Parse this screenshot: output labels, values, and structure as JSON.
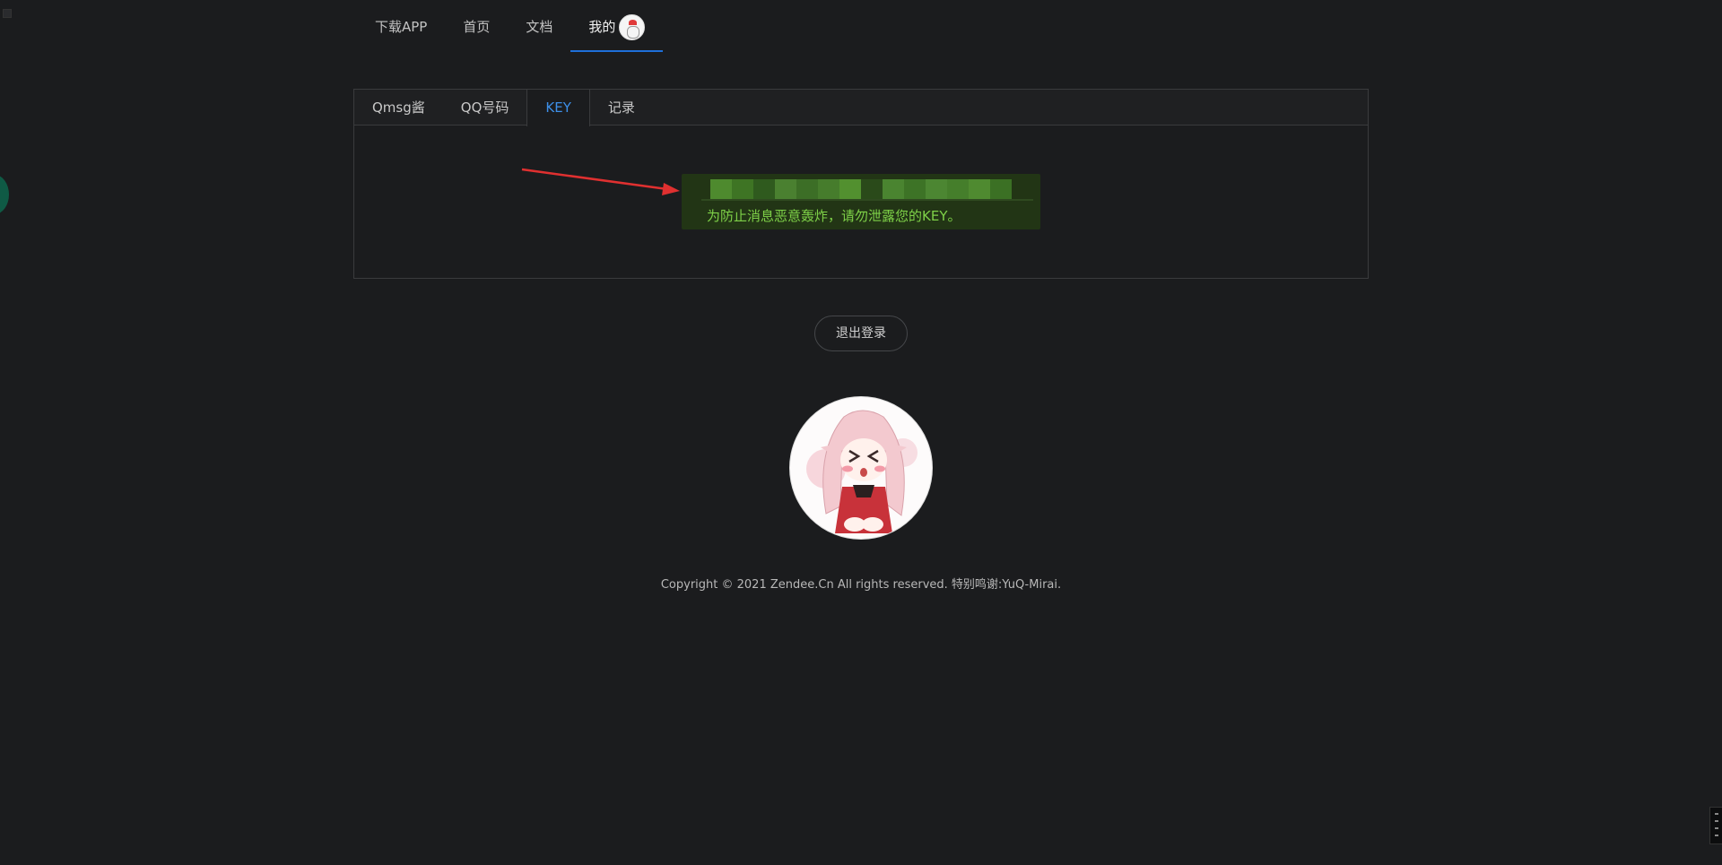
{
  "nav": {
    "items": [
      {
        "label": "下载APP"
      },
      {
        "label": "首页"
      },
      {
        "label": "文档"
      },
      {
        "label": "我的"
      }
    ]
  },
  "tabs": [
    {
      "label": "Qmsg酱"
    },
    {
      "label": "QQ号码"
    },
    {
      "label": "KEY"
    },
    {
      "label": "记录"
    }
  ],
  "active_tab": "KEY",
  "key_panel": {
    "warning": "为防止消息恶意轰炸，请勿泄露您的KEY。"
  },
  "logout_label": "退出登录",
  "footer": {
    "copyright": "Copyright © 2021 Zendee.Cn All rights reserved. 特别鸣谢:YuQ-Mirai."
  },
  "colors": {
    "background": "#1b1c1e",
    "accent_blue": "#3d8fe8",
    "key_box_bg": "#223515",
    "key_text": "#7ed148",
    "arrow": "#e03030"
  }
}
